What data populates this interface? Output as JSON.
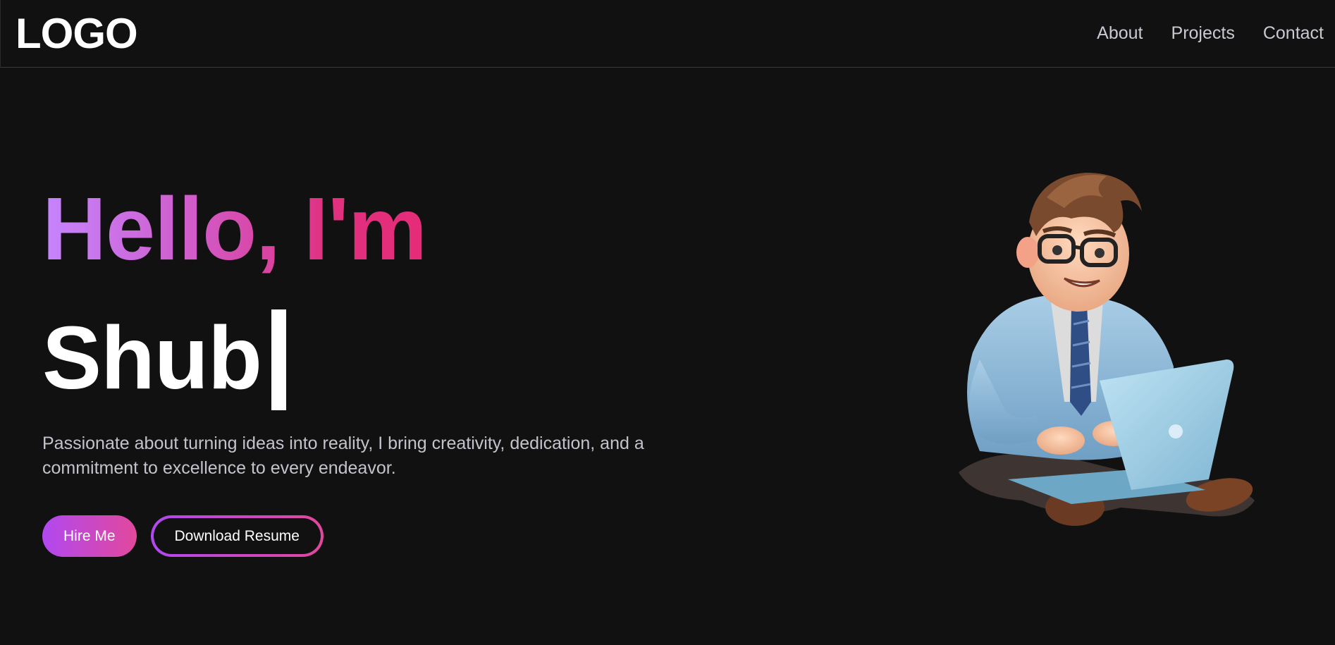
{
  "nav": {
    "logo": "LOGO",
    "links": [
      "About",
      "Projects",
      "Contact"
    ]
  },
  "hero": {
    "greeting": "Hello, I'm",
    "name": "Shub",
    "tagline": "Passionate about turning ideas into reality, I bring creativity, dedication, and a commitment to excellence to every endeavor.",
    "primary_button": "Hire Me",
    "secondary_button": "Download Resume"
  },
  "colors": {
    "background": "#111111",
    "gradient_start": "#c585ff",
    "gradient_end": "#e62c78",
    "button_gradient_start": "#b148f0",
    "button_gradient_end": "#e2489c"
  },
  "illustration": {
    "icon": "developer-avatar-illustration"
  }
}
